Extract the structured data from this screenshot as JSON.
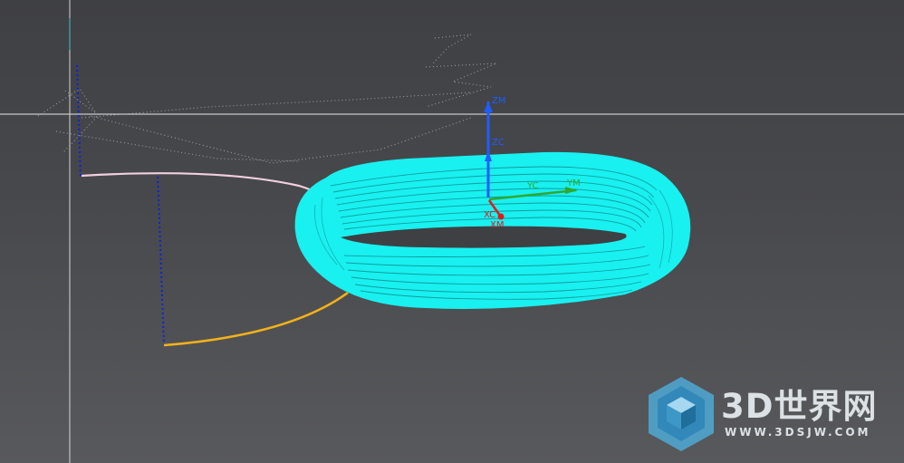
{
  "viewport": {
    "axes": {
      "zm_label": "ZM",
      "zc_label": "ZC",
      "xc_label": "XC",
      "yc_label": "YC",
      "ym_label": "YM",
      "xm_label": "XM"
    }
  },
  "watermark": {
    "title": "3D世界网",
    "url": "WWW.3DSJW.COM",
    "logo_icon": "cube-logo-icon"
  },
  "colors": {
    "background_top": "#3f4043",
    "background_bottom": "#58595c",
    "ring_wireframe": "#19f0f0",
    "z_axis": "#1f5cff",
    "x_axis": "#e01a1a",
    "y_axis": "#2fa830",
    "guide_curve_top": "#f2cfe0",
    "guide_curve_bottom": "#f2b21a",
    "dotted_guide": "#0d1fe8"
  }
}
